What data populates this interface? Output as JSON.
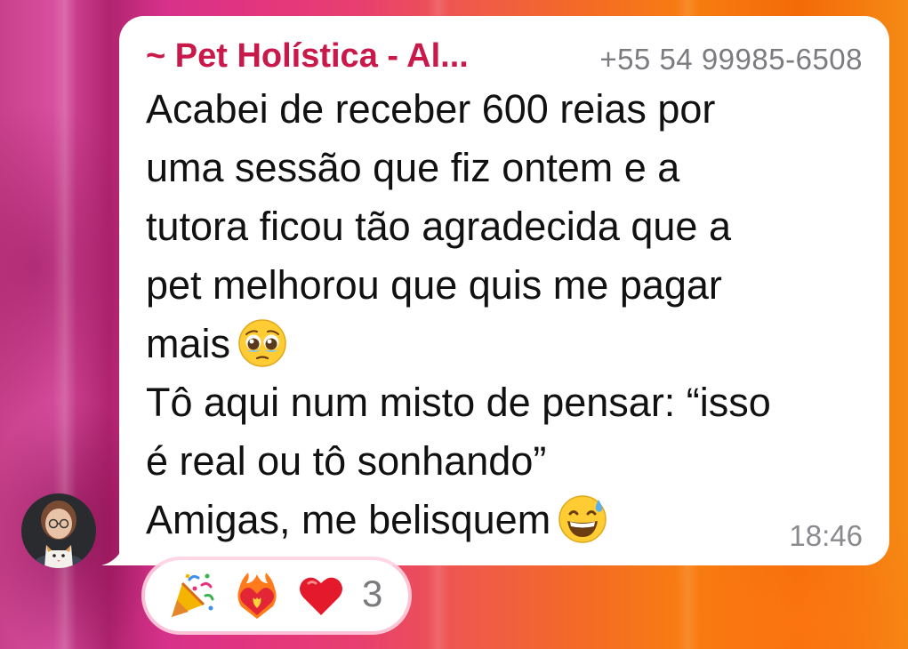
{
  "message": {
    "sender_name": "~ Pet Holística - Al...",
    "sender_phone": "+55 54 99985-6508",
    "lines": [
      "Acabei de receber 600 reias por",
      "uma sessão que fiz ontem e a",
      "tutora ficou tão agradecida que a",
      "pet melhorou que quis me pagar",
      "mais",
      "Tô aqui num misto de pensar: “isso",
      "é real ou tô sonhando”",
      "Amigas, me belisquem"
    ],
    "time": "18:46"
  },
  "reactions": {
    "items": [
      {
        "icon": "party-popper-icon"
      },
      {
        "icon": "heart-on-fire-icon"
      },
      {
        "icon": "red-heart-icon"
      }
    ],
    "count": "3"
  },
  "colors": {
    "sender_name": "#c9184a",
    "bubble": "#ffffff",
    "timestamp": "#8a8a8f"
  }
}
